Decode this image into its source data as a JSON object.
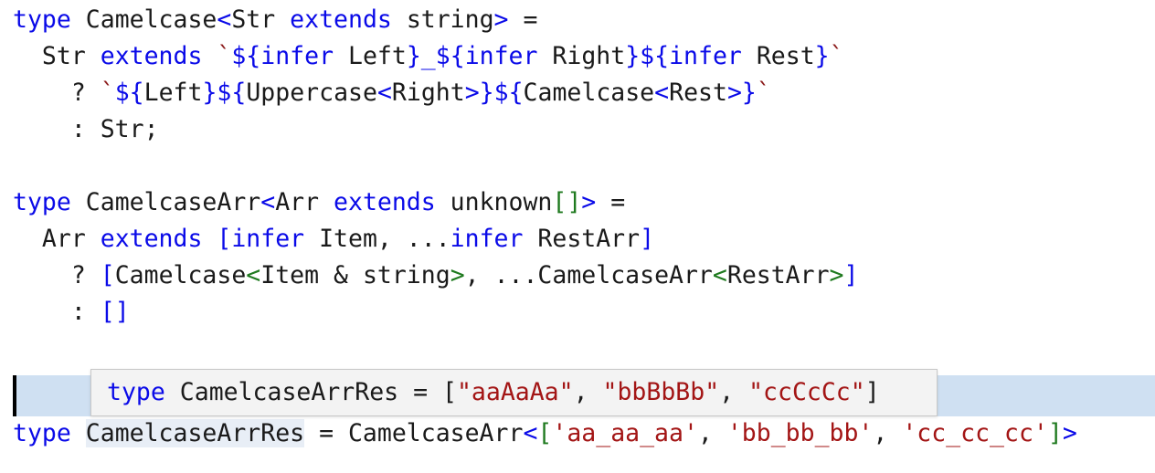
{
  "editor": {
    "language": "typescript",
    "background_color": "#ffffff",
    "font_size_px": 26.5,
    "line_height_px": 40,
    "colors": {
      "keyword": "#0a0ae8",
      "plain": "#1a1a1a",
      "bracket_level_1": "#0a0ae8",
      "bracket_level_2": "#1f7a1f",
      "string": "#a31515",
      "backtick": "#8b1a1a",
      "selection": "#cfe0f2",
      "occurrence_highlight": "#e8eef6",
      "tooltip_background": "#f3f3f3",
      "tooltip_border": "#c8c8c8",
      "caret": "#000000"
    }
  },
  "code": {
    "line_0": {
      "t1": "type ",
      "t2": "Camelcase",
      "t3": "<",
      "t4": "Str ",
      "t5": "extends ",
      "t6": "string",
      "t7": ">",
      "t8": " ="
    },
    "line_1": {
      "t1": "  Str ",
      "t2": "extends ",
      "t3": "`",
      "t4": "${",
      "t5": "infer ",
      "t6": "Left",
      "t7": "}",
      "t8": "_",
      "t9": "${",
      "t10": "infer ",
      "t11": "Right",
      "t12": "}",
      "t13": "${",
      "t14": "infer ",
      "t15": "Rest",
      "t16": "}",
      "t17": "`"
    },
    "line_2": {
      "t1": "    ? ",
      "t2": "`",
      "t3": "${",
      "t4": "Left",
      "t5": "}",
      "t6": "${",
      "t7": "Uppercase",
      "t8": "<",
      "t9": "Right",
      "t10": ">",
      "t11": "}",
      "t12": "${",
      "t13": "Camelcase",
      "t14": "<",
      "t15": "Rest",
      "t16": ">",
      "t17": "}",
      "t18": "`"
    },
    "line_3": {
      "t1": "    : Str;"
    },
    "line_4": {
      "t1": ""
    },
    "line_5": {
      "t1": "type ",
      "t2": "CamelcaseArr",
      "t3": "<",
      "t4": "Arr ",
      "t5": "extends ",
      "t6": "unknown",
      "t7": "[]",
      "t8": ">",
      "t9": " ="
    },
    "line_6": {
      "t1": "  Arr ",
      "t2": "extends ",
      "t3": "[",
      "t4": "infer ",
      "t5": "Item, ...",
      "t6": "infer ",
      "t7": "RestArr",
      "t8": "]"
    },
    "line_7": {
      "t1": "    ? ",
      "t2": "[",
      "t3": "Camelcase",
      "t4": "<",
      "t5": "Item & string",
      "t6": ">",
      "t7": ", ...CamelcaseArr",
      "t8": "<",
      "t9": "RestArr",
      "t10": ">",
      "t11": "]"
    },
    "line_8": {
      "t1": "    : ",
      "t2": "[]"
    },
    "line_9": {
      "t1": ""
    },
    "line_10": {
      "t1": ""
    },
    "line_11": {
      "t1": "type ",
      "t2": "CamelcaseArrRes",
      "t3": " = CamelcaseArr",
      "t4": "<",
      "t5": "[",
      "t6": "'aa_aa_aa'",
      "t7": ", ",
      "t8": "'bb_bb_bb'",
      "t9": ", ",
      "t10": "'cc_cc_cc'",
      "t11": "]",
      "t12": ">"
    }
  },
  "tooltip": {
    "visible": true,
    "t1": "type ",
    "t2": "CamelcaseArrRes",
    "t3": " = ",
    "t4": "[",
    "t5": "\"aaAaAa\"",
    "t6": ", ",
    "t7": "\"bbBbBb\"",
    "t8": ", ",
    "t9": "\"ccCcCc\"",
    "t10": "]"
  }
}
